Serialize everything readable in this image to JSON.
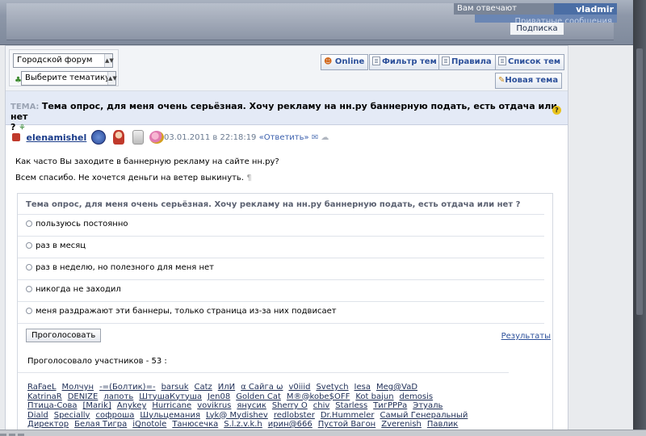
{
  "header": {
    "answers_label": "Вам отвечают",
    "username": "vladmir",
    "private_messages": "Приватные сообщения",
    "subscription": "Подписка"
  },
  "toolbar": {
    "forum_select": "Городской форум",
    "theme_select": "Выберите тематику",
    "online": "Online",
    "filter": "Фильтр тем",
    "rules": "Правила",
    "topic_list": "Список тем",
    "new_topic": "Новая тема"
  },
  "topic": {
    "label": "ТЕМА:",
    "title": "Тема опрос, для меня очень серьёзная. Хочу рекламу на нн.ру баннерную подать, есть отдача или нет",
    "title_end": "?"
  },
  "post": {
    "author": "elenamishel",
    "date": "03.01.2011 в 22:18:19",
    "reply": "«Ответить»",
    "line1": "Как часто Вы заходите в баннерную рекламу на сайте нн.ру?",
    "line2": "Всем спасибо. Не хочется деньги на ветер выкинуть."
  },
  "poll": {
    "title": "Тема опрос, для меня очень серьёзная. Хочу рекламу на нн.ру баннерную подать, есть отдача или нет ?",
    "options": [
      "пользуюсь постоянно",
      "раз в месяц",
      "раз в неделю, но полезного для меня нет",
      "никогда не заходил",
      "меня раздражают эти баннеры, только страница из-за них подвисает"
    ],
    "vote_button": "Проголосовать",
    "results_link": "Результаты",
    "voted_count": "Проголосовало участников - 53 :"
  },
  "voters": [
    [
      "RaFaeL",
      "Молчун",
      "-=(Болтик)=-",
      "barsuk",
      "Catz",
      "ИлИ",
      "α Сайга ω",
      "v0iiid",
      "Svetych",
      "Iesa",
      "Meg@VaD"
    ],
    [
      "KatrinaR",
      "DENIZE",
      "лапоть",
      "ШтушаКутуша",
      "Jen08",
      "Golden Cat",
      "M®@kobe$OFF",
      "Kot bajun",
      "demosis"
    ],
    [
      "Птица-Сова",
      "[Marik]",
      "Anykey",
      "Hurricane",
      "vovikrus",
      "янусик",
      "Sherry O",
      "chiv",
      "Starless",
      "ТигРРРа",
      "Этуаль"
    ],
    [
      "Diald",
      "Specially",
      "софроша",
      "Шульцемания",
      "Lyk@ Mydishev",
      "redlobster",
      "Dr.Hummeler",
      "Самый Генеральный"
    ],
    [
      "Директор",
      "Белая Тигра",
      "iQnotole",
      "Танюсечка",
      "S.l.z.v.k.h",
      "ирин@666",
      "Пустой Вагон",
      "Zverenish",
      "Павлик"
    ]
  ]
}
